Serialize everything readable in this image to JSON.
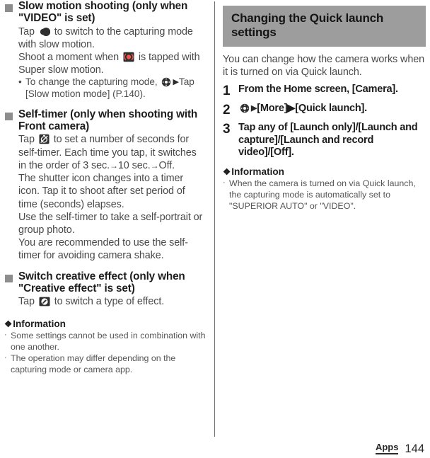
{
  "left_column": {
    "sections": [
      {
        "bullet": "square-bullet",
        "title": "Slow motion shooting (only when \"VIDEO\" is set)",
        "paragraphs": [
          {
            "pre": "Tap ",
            "icon": "slow-motion-icon",
            "post": " to switch to the capturing mode with slow motion."
          },
          {
            "pre": "Shoot a moment when ",
            "icon": "super-slow-motion-icon",
            "post": " is tapped with Super slow motion."
          }
        ],
        "sub_bullets": [
          {
            "dot": "•",
            "pre": "To change the capturing mode, ",
            "icon": "settings-dial-icon",
            "arrow": "▶",
            "post": "Tap [Slow motion mode] (P.140)."
          }
        ]
      },
      {
        "bullet": "square-bullet",
        "title": "Self-timer (only when shooting with Front camera)",
        "paragraphs": [
          {
            "pre": "Tap ",
            "icon": "self-timer-icon",
            "post": " to set a number of seconds for self-timer. Each time you tap, it switches in the order of 3 sec.→3 10 sec.→Off."
          },
          {
            "pre": "",
            "icon": "",
            "post": "The shutter icon changes into a timer icon. Tap it to shoot after set period of time (seconds) elapses."
          },
          {
            "pre": "",
            "icon": "",
            "post": "Use the self-timer to take a self-portrait or group photo."
          },
          {
            "pre": "",
            "icon": "",
            "post": "You are recommended to use the self-timer for avoiding camera shake."
          }
        ],
        "sub_bullets": []
      },
      {
        "bullet": "square-bullet",
        "title": "Switch creative effect (only when \"Creative effect\" is set)",
        "paragraphs": [
          {
            "pre": "Tap ",
            "icon": "creative-effect-icon",
            "post": " to switch a type of effect."
          }
        ],
        "sub_bullets": []
      }
    ],
    "self_timer_line1_a": "Tap ",
    "self_timer_line1_b": " to set a number of seconds for self-timer. Each time you tap, it switches in the order of 3 sec.",
    "self_timer_line1_c": "10 sec.",
    "self_timer_line1_d": "Off.",
    "arrow_glyph": "→",
    "information": {
      "heading_glyph": "❖",
      "heading": "Information",
      "items": [
        "Some settings cannot be used in combination with one another.",
        "The operation may differ depending on the capturing mode or camera app."
      ],
      "bullet": "·"
    }
  },
  "right_column": {
    "banner_title": "Changing the Quick launch settings",
    "intro": "You can change how the camera works when it is turned on via Quick launch.",
    "steps": [
      {
        "number": "1",
        "text": "From the Home screen, [Camera].",
        "icon": "",
        "arrow": ""
      },
      {
        "number": "2",
        "text": "[More]▶[Quick launch].",
        "icon": "settings-dial-icon",
        "arrow": "▶"
      },
      {
        "number": "3",
        "text": "Tap any of [Launch only]/[Launch and capture]/[Launch and record video]/[Off].",
        "icon": "",
        "arrow": ""
      }
    ],
    "information": {
      "heading_glyph": "❖",
      "heading": "Information",
      "items": [
        "When the camera is turned on via Quick launch, the capturing mode is automatically set to \"SUPERIOR AUTO\" or \"VIDEO\"."
      ],
      "bullet": "·"
    }
  },
  "footer": {
    "label": "Apps",
    "page_number": "144"
  },
  "colors": {
    "banner_bg": "#9d9d9d",
    "square_bullet": "#8d8d8d",
    "divider": "#6e6e6e",
    "body_text": "#494949",
    "heading_text": "#1d1d1d",
    "accent_red": "#f0554c"
  }
}
